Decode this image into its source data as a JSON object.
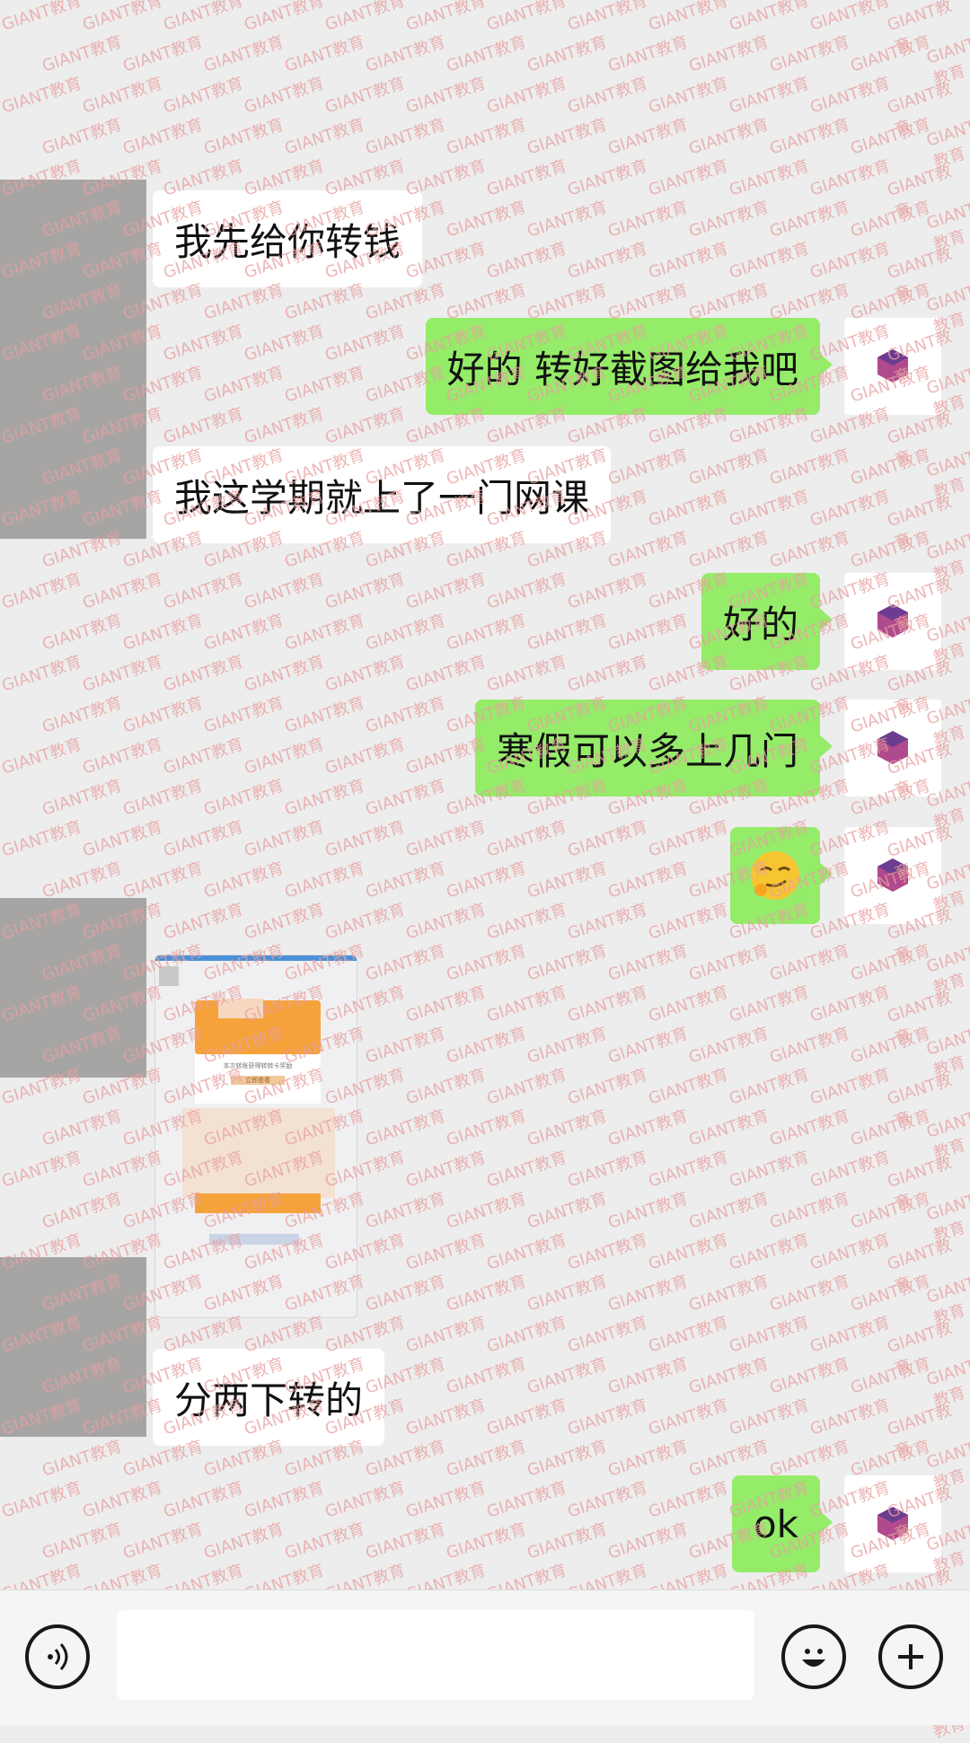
{
  "messages": [
    {
      "side": "in",
      "text": "我先给你转钱"
    },
    {
      "side": "out",
      "text": "好的 转好截图给我吧"
    },
    {
      "side": "in",
      "text": "我这学期就上了一门网课"
    },
    {
      "side": "out",
      "text": "好的"
    },
    {
      "side": "out",
      "text": "寒假可以多上几门"
    },
    {
      "side": "out",
      "icon": "smirk-emoji-icon"
    },
    {
      "side": "in",
      "image": "blurred-screenshot"
    },
    {
      "side": "in",
      "text": "分两下转的"
    },
    {
      "side": "out",
      "text": "ok"
    }
  ],
  "screenshot": {
    "banner_text": "本次转账获得转转卡奖励",
    "button_text": "立即查看"
  },
  "watermark": "GIANT教育",
  "colors": {
    "outgoing": "#95ec69",
    "incoming": "#ffffff",
    "background": "#ededed"
  },
  "bottom_bar": {
    "voice_icon": "voice-icon",
    "emoji_icon": "emoji-icon",
    "plus_icon": "plus-icon"
  }
}
